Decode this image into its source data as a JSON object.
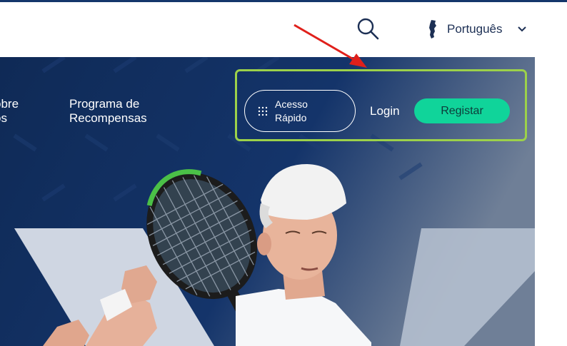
{
  "header": {
    "search_icon": "search-icon",
    "language": {
      "label": "Português",
      "flag_icon": "portugal-map-icon",
      "chevron_icon": "chevron-down-icon"
    }
  },
  "hero": {
    "nav": {
      "about_line1": "obre",
      "about_line2": "ós",
      "rewards_line1": "Programa de",
      "rewards_line2": "Recompensas"
    },
    "quick_access": {
      "line1": "Acesso",
      "line2": "Rápido",
      "icon": "grid-dots-icon"
    },
    "login_label": "Login",
    "register_label": "Registar",
    "image_description": "Tennis player wearing a white backwards cap swinging a racket"
  },
  "colors": {
    "brand_navy": "#0f2a56",
    "top_stripe": "#14366b",
    "register_green": "#10d49a",
    "highlight_outline": "#9cd14a",
    "annotation_arrow": "#e0201b"
  }
}
